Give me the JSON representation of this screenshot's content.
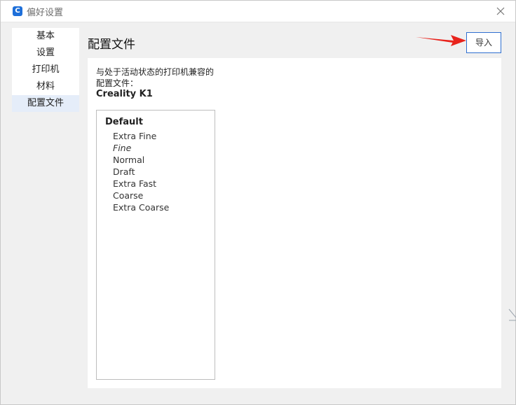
{
  "window": {
    "title": "偏好设置",
    "app_icon": "C",
    "close_icon": "close-icon"
  },
  "sidebar": {
    "items": [
      {
        "label": "基本",
        "active": false
      },
      {
        "label": "设置",
        "active": false
      },
      {
        "label": "打印机",
        "active": false
      },
      {
        "label": "材料",
        "active": false
      },
      {
        "label": "配置文件",
        "active": true
      }
    ]
  },
  "main": {
    "title": "配置文件",
    "import_label": "导入",
    "description": "与处于活动状态的打印机兼容的",
    "description_line2": "配置文件：",
    "printer_name": "Creality K1",
    "profile_group": "Default",
    "profiles": [
      {
        "label": "Extra Fine",
        "italic": false
      },
      {
        "label": "Fine",
        "italic": true
      },
      {
        "label": "Normal",
        "italic": false
      },
      {
        "label": "Draft",
        "italic": false
      },
      {
        "label": "Extra Fast",
        "italic": false
      },
      {
        "label": "Coarse",
        "italic": false
      },
      {
        "label": "Extra Coarse",
        "italic": false
      }
    ]
  },
  "colors": {
    "accent": "#2f6fd0",
    "arrow": "#e8231c",
    "active_item_bg": "#e5edf9"
  }
}
